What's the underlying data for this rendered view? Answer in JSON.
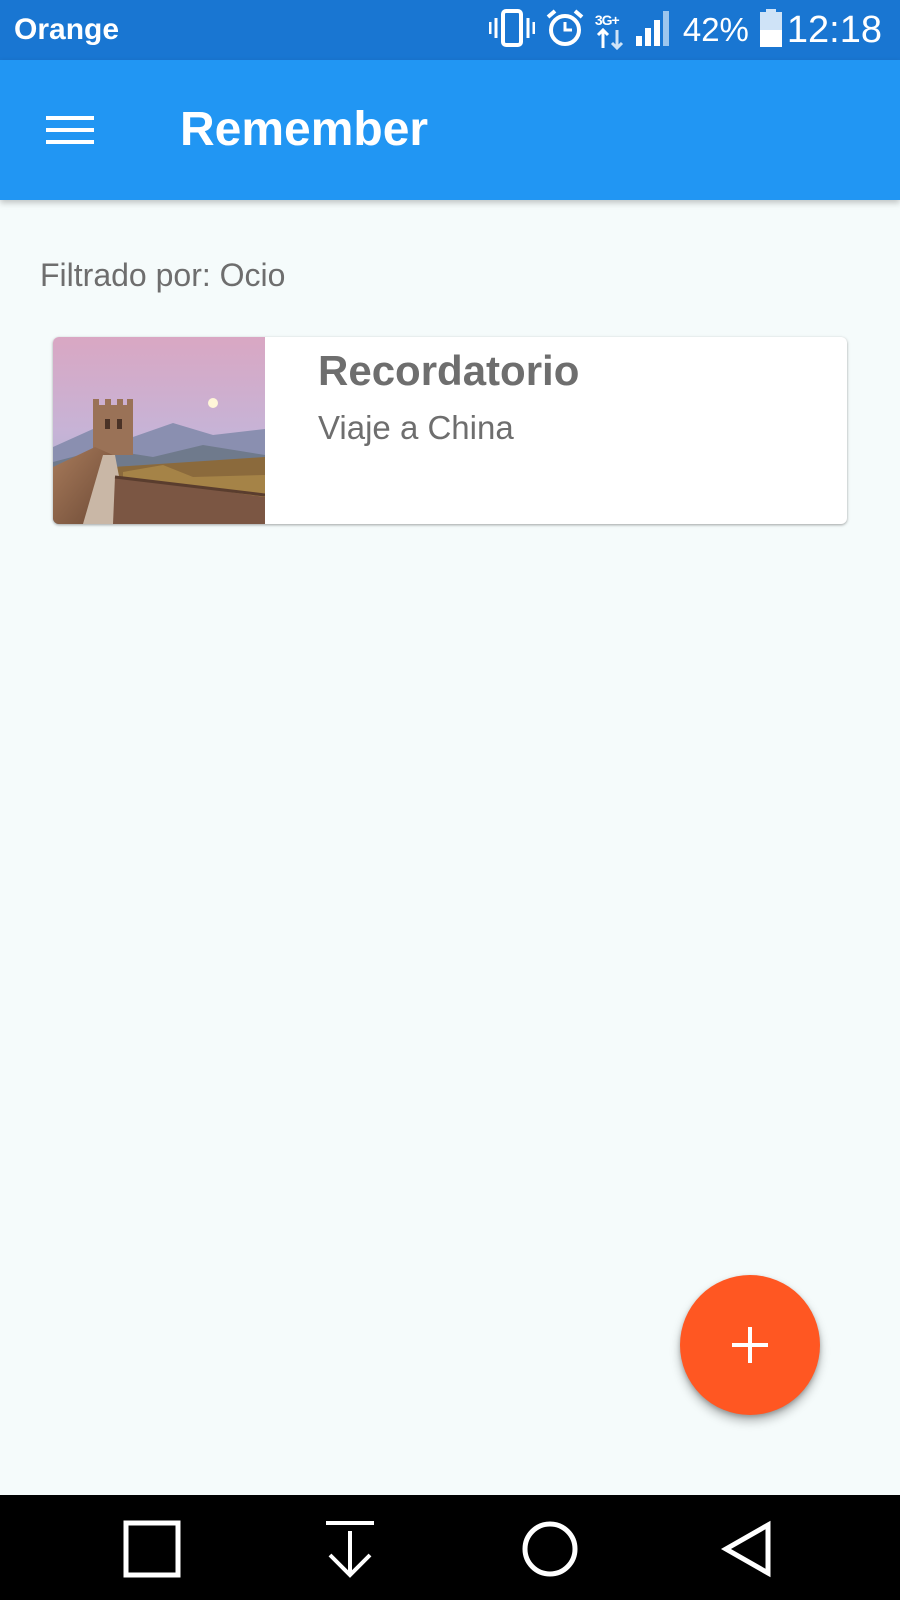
{
  "status_bar": {
    "carrier": "Orange",
    "battery": "42%",
    "time": "12:18",
    "network": "3G+",
    "icons": [
      "vibrate-icon",
      "alarm-icon",
      "network-3g-icon",
      "signal-icon",
      "battery-icon"
    ]
  },
  "app_bar": {
    "title": "Remember",
    "menu_icon": "menu-icon",
    "color": "#2196f3"
  },
  "filter": {
    "label": "Filtrado por: Ocio"
  },
  "reminders": [
    {
      "title": "Recordatorio",
      "subtitle": "Viaje a China",
      "image": "great-wall-photo"
    }
  ],
  "fab": {
    "icon": "plus-icon",
    "color": "#ff5722"
  },
  "nav_bar": {
    "buttons": [
      "recent-apps-icon",
      "notifications-pull-icon",
      "home-icon",
      "back-icon"
    ]
  }
}
